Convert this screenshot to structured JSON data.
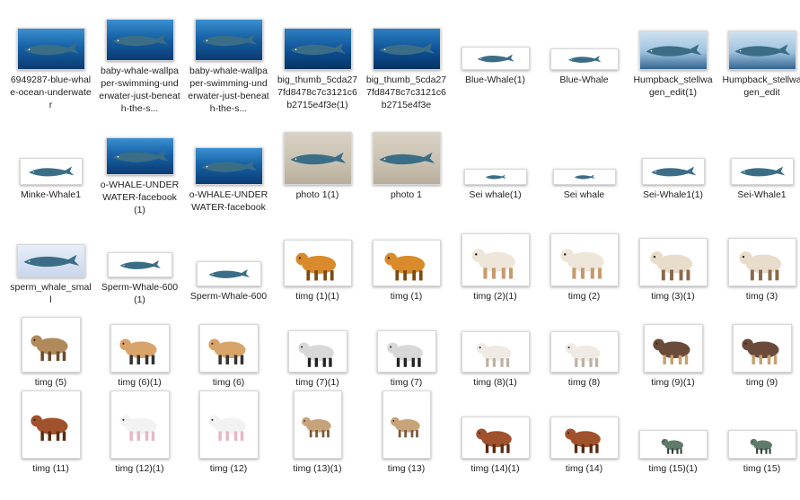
{
  "files": [
    {
      "name": "6949287-blue-whale-ocean-underwater",
      "thumb": "ocean",
      "icon": "whale-icon"
    },
    {
      "name": "baby-whale-wallpaper-swimming-underwater-just-beneath-the-s...",
      "thumb": "ocean",
      "icon": "whale-icon"
    },
    {
      "name": "baby-whale-wallpaper-swimming-underwater-just-beneath-the-s...",
      "thumb": "ocean",
      "icon": "whale-icon"
    },
    {
      "name": "big_thumb_5cda277fd8478c7c3121c6b2715e4f3e(1)",
      "thumb": "deep",
      "icon": "whale-icon"
    },
    {
      "name": "big_thumb_5cda277fd8478c7c3121c6b2715e4f3e",
      "thumb": "deep",
      "icon": "whale-icon"
    },
    {
      "name": "Blue-Whale(1)",
      "thumb": "white",
      "icon": "whale-icon"
    },
    {
      "name": "Blue-Whale",
      "thumb": "white",
      "icon": "whale-icon"
    },
    {
      "name": "Humpback_stellwagen_edit(1)",
      "thumb": "sky",
      "icon": "whale-icon"
    },
    {
      "name": "Humpback_stellwagen_edit",
      "thumb": "sky",
      "icon": "whale-icon"
    },
    {
      "name": "Minke-Whale1",
      "thumb": "white",
      "icon": "whale-icon"
    },
    {
      "name": "o-WHALE-UNDERWATER-facebook(1)",
      "thumb": "ocean",
      "icon": "whale-icon"
    },
    {
      "name": "o-WHALE-UNDERWATER-facebook",
      "thumb": "ocean",
      "icon": "whale-icon"
    },
    {
      "name": "photo 1(1)",
      "thumb": "wall",
      "icon": "whale-icon"
    },
    {
      "name": "photo 1",
      "thumb": "wall",
      "icon": "whale-icon"
    },
    {
      "name": "Sei whale(1)",
      "thumb": "white",
      "icon": "whale-icon"
    },
    {
      "name": "Sei whale",
      "thumb": "white",
      "icon": "whale-icon"
    },
    {
      "name": "Sei-Whale1(1)",
      "thumb": "white",
      "icon": "whale-icon"
    },
    {
      "name": "Sei-Whale1",
      "thumb": "white",
      "icon": "whale-icon"
    },
    {
      "name": "sperm_whale_small",
      "thumb": "soft",
      "icon": "whale-icon"
    },
    {
      "name": "Sperm-Whale-600(1)",
      "thumb": "white",
      "icon": "whale-icon"
    },
    {
      "name": "Sperm-Whale-600",
      "thumb": "white",
      "icon": "whale-icon"
    },
    {
      "name": "timg (1)(1)",
      "thumb": "white",
      "icon": "tiger-icon"
    },
    {
      "name": "timg (1)",
      "thumb": "white",
      "icon": "tiger-icon"
    },
    {
      "name": "timg (2)(1)",
      "thumb": "white",
      "icon": "dog-icon"
    },
    {
      "name": "timg (2)",
      "thumb": "white",
      "icon": "dog-icon"
    },
    {
      "name": "timg (3)(1)",
      "thumb": "white",
      "icon": "ram-icon"
    },
    {
      "name": "timg (3)",
      "thumb": "white",
      "icon": "ram-icon"
    },
    {
      "name": "timg (5)",
      "thumb": "white",
      "icon": "duck-icon"
    },
    {
      "name": "timg (6)(1)",
      "thumb": "white",
      "icon": "dog-cat-icon"
    },
    {
      "name": "timg (6)",
      "thumb": "white",
      "icon": "dog-cat-icon"
    },
    {
      "name": "timg (7)(1)",
      "thumb": "white",
      "icon": "zebra-icon"
    },
    {
      "name": "timg (7)",
      "thumb": "white",
      "icon": "zebra-icon"
    },
    {
      "name": "timg (8)(1)",
      "thumb": "white",
      "icon": "cat-icon"
    },
    {
      "name": "timg (8)",
      "thumb": "white",
      "icon": "cat-icon"
    },
    {
      "name": "timg (9)(1)",
      "thumb": "white",
      "icon": "chicken-icon"
    },
    {
      "name": "timg (9)",
      "thumb": "white",
      "icon": "chicken-icon"
    },
    {
      "name": "timg (11)",
      "thumb": "white",
      "icon": "horse-icon"
    },
    {
      "name": "timg (12)(1)",
      "thumb": "white",
      "icon": "kitten-icon"
    },
    {
      "name": "timg (12)",
      "thumb": "white",
      "icon": "kitten-icon"
    },
    {
      "name": "timg (13)(1)",
      "thumb": "white",
      "icon": "deer-icon"
    },
    {
      "name": "timg (13)",
      "thumb": "white",
      "icon": "deer-icon"
    },
    {
      "name": "timg (14)(1)",
      "thumb": "white",
      "icon": "horse-icon"
    },
    {
      "name": "timg (14)",
      "thumb": "white",
      "icon": "horse-icon"
    },
    {
      "name": "timg (15)(1)",
      "thumb": "white",
      "icon": "crocodile-icon"
    },
    {
      "name": "timg (15)",
      "thumb": "white",
      "icon": "crocodile-icon"
    }
  ]
}
